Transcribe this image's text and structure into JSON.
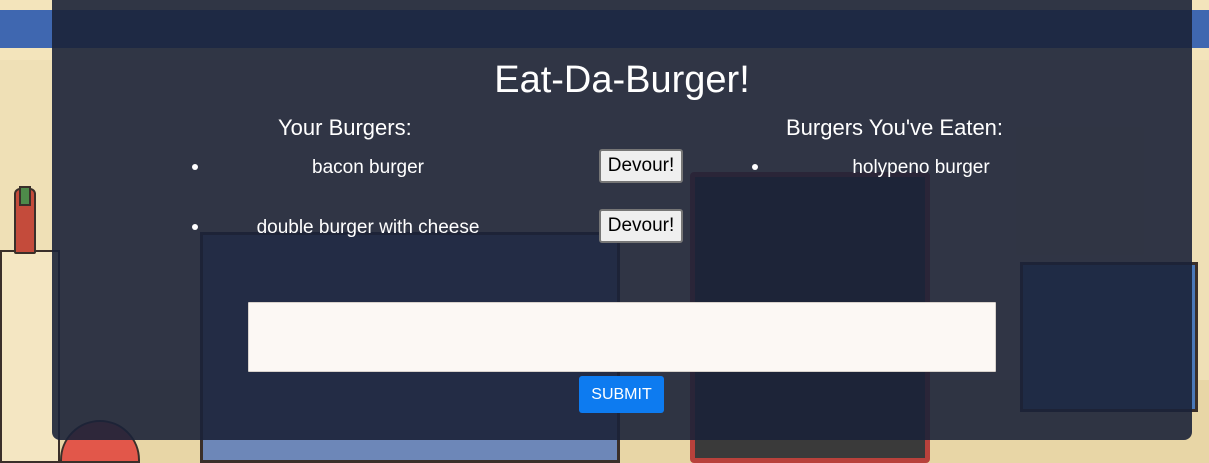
{
  "page": {
    "title": "Eat-Da-Burger!"
  },
  "your_burgers": {
    "heading": "Your Burgers:",
    "items": [
      {
        "name": "bacon burger",
        "action_label": "Devour!"
      },
      {
        "name": "double burger with cheese",
        "action_label": "Devour!"
      }
    ]
  },
  "eaten_burgers": {
    "heading": "Burgers You've Eaten:",
    "items": [
      {
        "name": "holypeno burger"
      }
    ]
  },
  "form": {
    "input_value": "",
    "submit_label": "SUBMIT"
  },
  "colors": {
    "panel": "#1b2238",
    "submit_button": "#0d7bf0",
    "input_bg": "#fcf8f4"
  }
}
